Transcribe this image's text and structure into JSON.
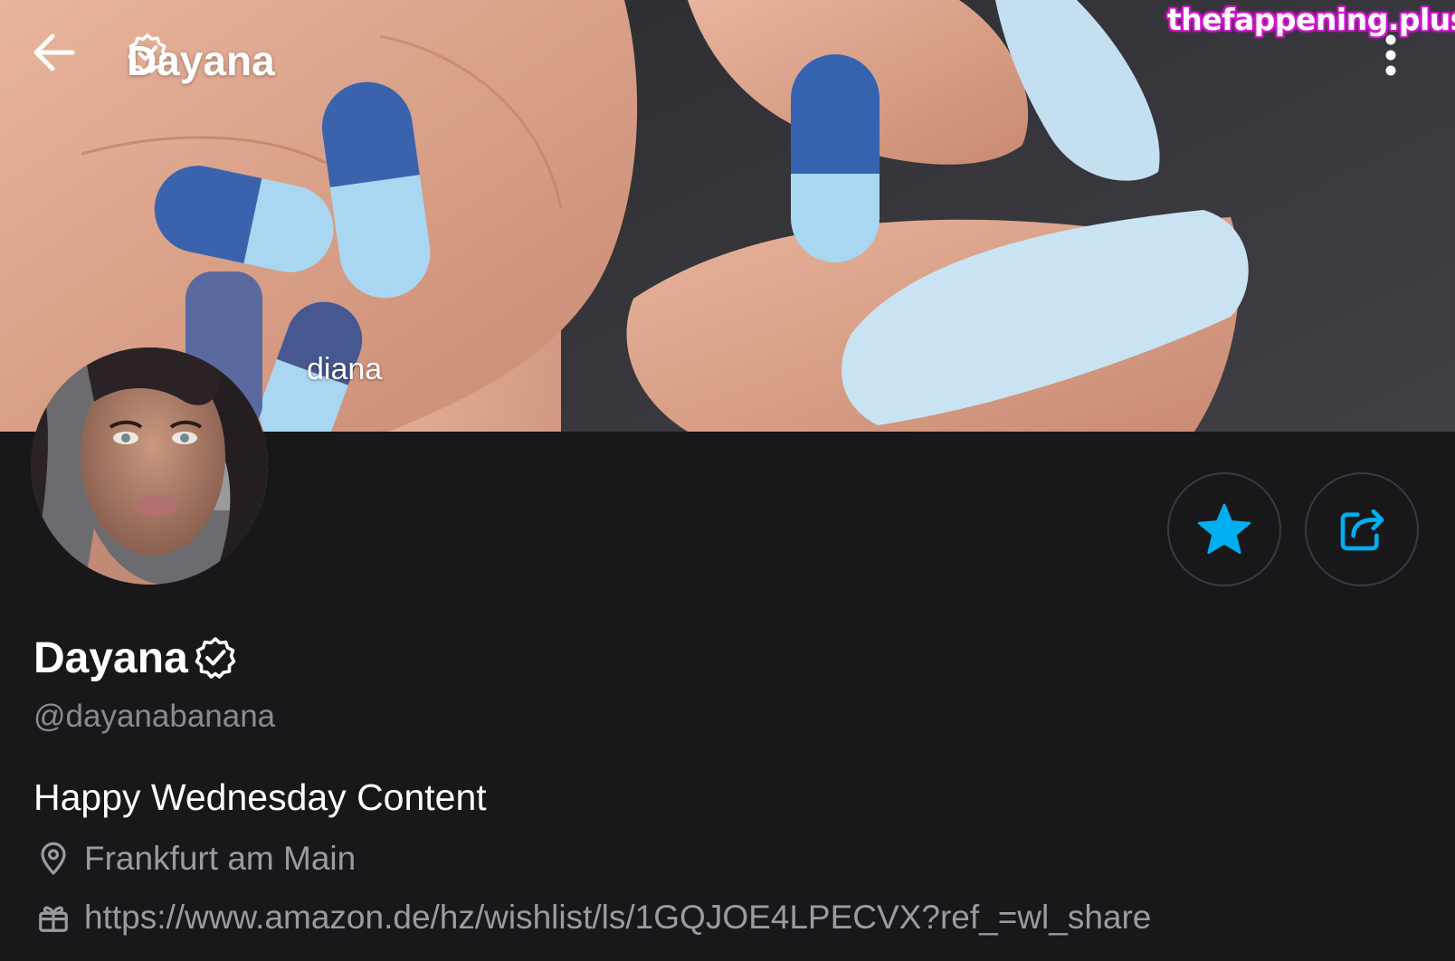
{
  "header": {
    "title": "Dayana",
    "back_icon": "arrow-left-icon",
    "verified_icon": "verified-badge-icon",
    "menu_icon": "more-vertical-icon"
  },
  "watermark": "thefappening.plus",
  "cover": {
    "caption": "diana"
  },
  "actions": {
    "favorite_icon": "star-icon",
    "share_icon": "share-icon",
    "accent_color": "#00aff0"
  },
  "profile": {
    "display_name": "Dayana",
    "handle": "@dayanabanana",
    "bio": "Happy Wednesday Content",
    "location": "Frankfurt am Main",
    "location_icon": "map-pin-icon",
    "link": "https://www.amazon.de/hz/wishlist/ls/1GQJOE4LPECVX?ref_=wl_share",
    "link_icon": "gift-icon"
  },
  "colors": {
    "background": "#18181b",
    "muted_text": "#8a8a93",
    "watermark_glow": "#e020d8"
  }
}
